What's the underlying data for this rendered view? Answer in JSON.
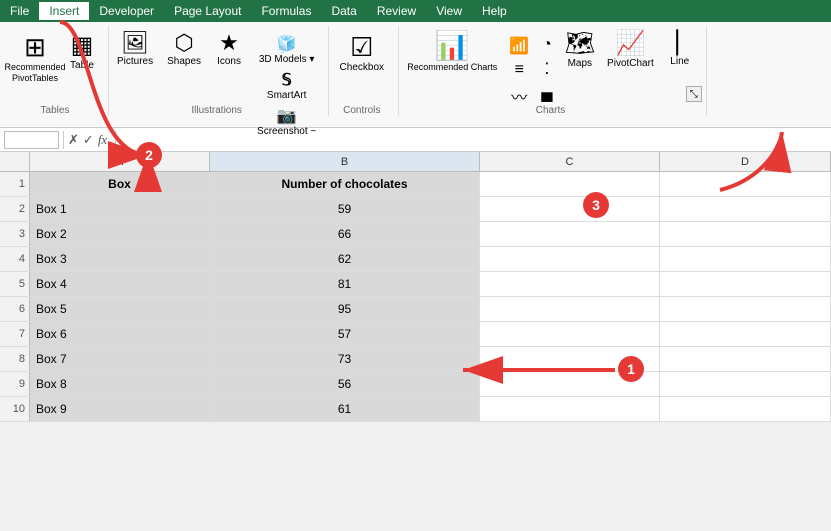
{
  "menu": {
    "items": [
      "File",
      "Insert",
      "Developer",
      "Page Layout",
      "Formulas",
      "Data",
      "Review",
      "View",
      "Help"
    ]
  },
  "ribbon": {
    "groups": [
      {
        "name": "Tables",
        "buttons": [
          {
            "label": "Recommended PivotTables",
            "icon": "⊞"
          },
          {
            "label": "Table",
            "icon": "▦"
          }
        ]
      },
      {
        "name": "Illustrations",
        "buttons": [
          {
            "label": "Pictures",
            "icon": "🖼"
          },
          {
            "label": "Shapes",
            "icon": "⬡"
          },
          {
            "label": "Icons",
            "icon": "★"
          }
        ],
        "dropdowns": [
          {
            "label": "3D Models",
            "icon": "🧊"
          },
          {
            "label": "SmartArt",
            "icon": "𝕊"
          },
          {
            "label": "Screenshot",
            "icon": "📷"
          }
        ]
      },
      {
        "name": "Controls",
        "buttons": [
          {
            "label": "Checkbox",
            "icon": "☑"
          }
        ]
      },
      {
        "name": "Charts",
        "buttons": [
          {
            "label": "Recommended Charts",
            "icon": "📊"
          },
          {
            "label": "Maps",
            "icon": "🗺"
          },
          {
            "label": "PivotChart",
            "icon": "📈"
          }
        ]
      }
    ],
    "recommended_charts_label": "Recommended\nCharts",
    "screenshot_label": "Screenshot ~"
  },
  "formula_bar": {
    "name_box_value": "",
    "formula_value": "fx",
    "cell_ref": ""
  },
  "spreadsheet": {
    "col_headers": [
      "",
      "A",
      "B",
      "C",
      "D"
    ],
    "rows": [
      {
        "num": "1",
        "a": "Box",
        "b": "Number of chocolates",
        "a_header": true,
        "b_header": true
      },
      {
        "num": "2",
        "a": "Box 1",
        "b": "59"
      },
      {
        "num": "3",
        "a": "Box 2",
        "b": "66"
      },
      {
        "num": "4",
        "a": "Box 3",
        "b": "62"
      },
      {
        "num": "5",
        "a": "Box 4",
        "b": "81"
      },
      {
        "num": "6",
        "a": "Box 5",
        "b": "95"
      },
      {
        "num": "7",
        "a": "Box 6",
        "b": "57"
      },
      {
        "num": "8",
        "a": "Box 7",
        "b": "73"
      },
      {
        "num": "9",
        "a": "Box 8",
        "b": "56"
      },
      {
        "num": "10",
        "a": "Box 9",
        "b": "61"
      }
    ]
  },
  "badges": {
    "badge1": "1",
    "badge2": "2",
    "badge3": "3"
  },
  "colors": {
    "excel_green": "#217346",
    "badge_red": "#e53935",
    "arrow_red": "#e53935"
  }
}
